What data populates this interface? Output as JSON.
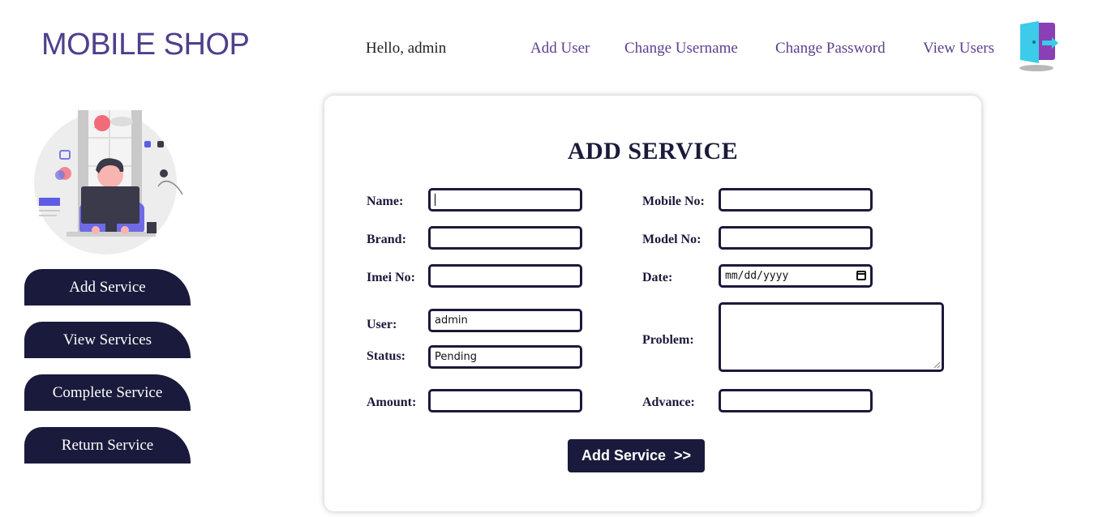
{
  "header": {
    "logo": "MOBILE SHOP",
    "greeting": "Hello, admin",
    "nav": [
      "Add User",
      "Change Username",
      "Change Password",
      "View Users"
    ],
    "logout_icon": "logout-door-icon"
  },
  "sidebar": {
    "illustration": "person-at-laptop-illustration",
    "items": [
      "Add Service",
      "View Services",
      "Complete Service",
      "Return Service"
    ]
  },
  "form": {
    "title": "ADD SERVICE",
    "labels": {
      "name": "Name:",
      "mobile": "Mobile No:",
      "brand": "Brand:",
      "model": "Model No:",
      "imei": "Imei No:",
      "date": "Date:",
      "user": "User:",
      "problem": "Problem:",
      "status": "Status:",
      "amount": "Amount:",
      "advance": "Advance:"
    },
    "values": {
      "name": "",
      "mobile": "",
      "brand": "",
      "model": "",
      "imei": "",
      "date": "mm/dd/yyyy",
      "user": "admin",
      "status": "Pending",
      "problem": "",
      "amount": "",
      "advance": ""
    },
    "submit_label": "Add Service  >>"
  },
  "colors": {
    "brand": "#4f3f8c",
    "nav_link": "#5b3f8f",
    "dark": "#1a1a3c"
  }
}
